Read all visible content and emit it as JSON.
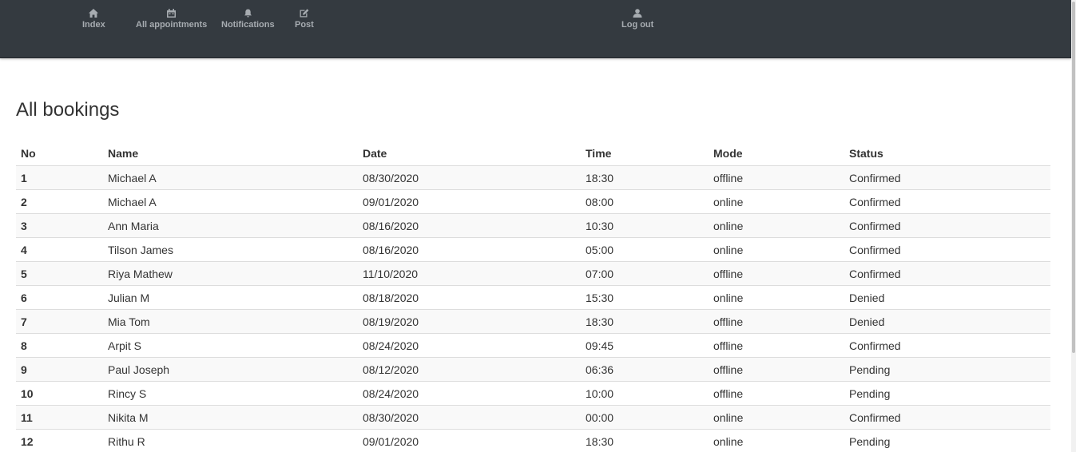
{
  "nav": {
    "items": [
      {
        "label": "Index",
        "icon": "home-icon"
      },
      {
        "label": "All appointments",
        "icon": "calendar-icon"
      },
      {
        "label": "Notifications",
        "icon": "bell-icon"
      },
      {
        "label": "Post",
        "icon": "edit-icon"
      }
    ],
    "logout": {
      "label": "Log out",
      "icon": "user-icon"
    }
  },
  "page": {
    "title": "All bookings"
  },
  "table": {
    "headers": {
      "no": "No",
      "name": "Name",
      "date": "Date",
      "time": "Time",
      "mode": "Mode",
      "status": "Status"
    },
    "rows": [
      {
        "no": "1",
        "name": "Michael A",
        "date": "08/30/2020",
        "time": "18:30",
        "mode": "offline",
        "status": "Confirmed"
      },
      {
        "no": "2",
        "name": "Michael A",
        "date": "09/01/2020",
        "time": "08:00",
        "mode": "online",
        "status": "Confirmed"
      },
      {
        "no": "3",
        "name": "Ann Maria",
        "date": "08/16/2020",
        "time": "10:30",
        "mode": "online",
        "status": "Confirmed"
      },
      {
        "no": "4",
        "name": "Tilson James",
        "date": "08/16/2020",
        "time": "05:00",
        "mode": "online",
        "status": "Confirmed"
      },
      {
        "no": "5",
        "name": "Riya Mathew",
        "date": "11/10/2020",
        "time": "07:00",
        "mode": "offline",
        "status": "Confirmed"
      },
      {
        "no": "6",
        "name": "Julian M",
        "date": "08/18/2020",
        "time": "15:30",
        "mode": "online",
        "status": "Denied"
      },
      {
        "no": "7",
        "name": "Mia Tom",
        "date": "08/19/2020",
        "time": "18:30",
        "mode": "offline",
        "status": "Denied"
      },
      {
        "no": "8",
        "name": "Arpit S",
        "date": "08/24/2020",
        "time": "09:45",
        "mode": "offline",
        "status": "Confirmed"
      },
      {
        "no": "9",
        "name": "Paul Joseph",
        "date": "08/12/2020",
        "time": "06:36",
        "mode": "offline",
        "status": "Pending"
      },
      {
        "no": "10",
        "name": "Rincy S",
        "date": "08/24/2020",
        "time": "10:00",
        "mode": "offline",
        "status": "Pending"
      },
      {
        "no": "11",
        "name": "Nikita M",
        "date": "08/30/2020",
        "time": "00:00",
        "mode": "online",
        "status": "Confirmed"
      },
      {
        "no": "12",
        "name": "Rithu R",
        "date": "09/01/2020",
        "time": "18:30",
        "mode": "online",
        "status": "Pending"
      }
    ]
  },
  "colors": {
    "navbar": "#343a40",
    "nav_text": "#a7acb1",
    "stripe": "#f9f9f9",
    "border": "#dddddd"
  }
}
